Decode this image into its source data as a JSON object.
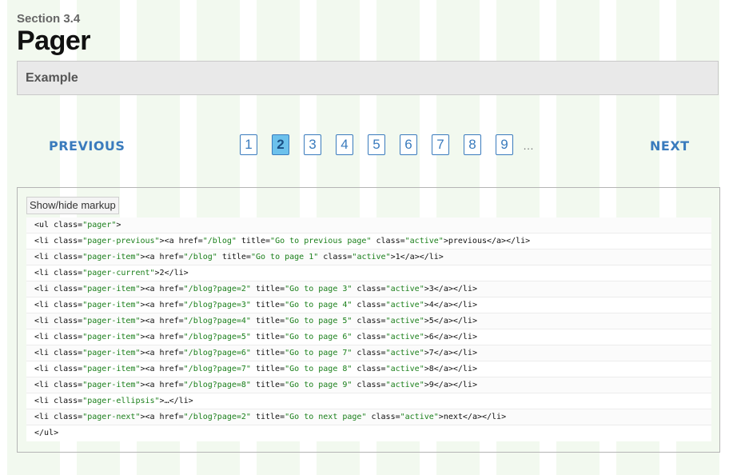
{
  "header": {
    "section": "Section 3.4",
    "title": "Pager"
  },
  "example": {
    "label": "Example"
  },
  "pager": {
    "previous_label": "PREVIOUS",
    "next_label": "NEXT",
    "items": [
      "1",
      "2",
      "3",
      "4",
      "5",
      "6",
      "7",
      "8",
      "9"
    ],
    "current": "2",
    "ellipsis": "…"
  },
  "markup": {
    "toggle_label": "Show/hide markup",
    "lines": [
      [
        [
          "t",
          "<ul class="
        ],
        [
          "s",
          "\"pager\""
        ],
        [
          "t",
          ">"
        ]
      ],
      [
        [
          "t",
          "<li class="
        ],
        [
          "s",
          "\"pager-previous\""
        ],
        [
          "t",
          "><a href="
        ],
        [
          "s",
          "\"/blog\""
        ],
        [
          "t",
          " title="
        ],
        [
          "s",
          "\"Go to previous page\""
        ],
        [
          "t",
          " class="
        ],
        [
          "s",
          "\"active\""
        ],
        [
          "t",
          ">previous</a></li>"
        ]
      ],
      [
        [
          "t",
          "<li class="
        ],
        [
          "s",
          "\"pager-item\""
        ],
        [
          "t",
          "><a href="
        ],
        [
          "s",
          "\"/blog\""
        ],
        [
          "t",
          " title="
        ],
        [
          "s",
          "\"Go to page 1\""
        ],
        [
          "t",
          " class="
        ],
        [
          "s",
          "\"active\""
        ],
        [
          "t",
          ">1</a></li>"
        ]
      ],
      [
        [
          "t",
          "<li class="
        ],
        [
          "s",
          "\"pager-current\""
        ],
        [
          "t",
          ">2</li>"
        ]
      ],
      [
        [
          "t",
          "<li class="
        ],
        [
          "s",
          "\"pager-item\""
        ],
        [
          "t",
          "><a href="
        ],
        [
          "s",
          "\"/blog?page=2\""
        ],
        [
          "t",
          " title="
        ],
        [
          "s",
          "\"Go to page 3\""
        ],
        [
          "t",
          " class="
        ],
        [
          "s",
          "\"active\""
        ],
        [
          "t",
          ">3</a></li>"
        ]
      ],
      [
        [
          "t",
          "<li class="
        ],
        [
          "s",
          "\"pager-item\""
        ],
        [
          "t",
          "><a href="
        ],
        [
          "s",
          "\"/blog?page=3\""
        ],
        [
          "t",
          " title="
        ],
        [
          "s",
          "\"Go to page 4\""
        ],
        [
          "t",
          " class="
        ],
        [
          "s",
          "\"active\""
        ],
        [
          "t",
          ">4</a></li>"
        ]
      ],
      [
        [
          "t",
          "<li class="
        ],
        [
          "s",
          "\"pager-item\""
        ],
        [
          "t",
          "><a href="
        ],
        [
          "s",
          "\"/blog?page=4\""
        ],
        [
          "t",
          " title="
        ],
        [
          "s",
          "\"Go to page 5\""
        ],
        [
          "t",
          " class="
        ],
        [
          "s",
          "\"active\""
        ],
        [
          "t",
          ">5</a></li>"
        ]
      ],
      [
        [
          "t",
          "<li class="
        ],
        [
          "s",
          "\"pager-item\""
        ],
        [
          "t",
          "><a href="
        ],
        [
          "s",
          "\"/blog?page=5\""
        ],
        [
          "t",
          " title="
        ],
        [
          "s",
          "\"Go to page 6\""
        ],
        [
          "t",
          " class="
        ],
        [
          "s",
          "\"active\""
        ],
        [
          "t",
          ">6</a></li>"
        ]
      ],
      [
        [
          "t",
          "<li class="
        ],
        [
          "s",
          "\"pager-item\""
        ],
        [
          "t",
          "><a href="
        ],
        [
          "s",
          "\"/blog?page=6\""
        ],
        [
          "t",
          " title="
        ],
        [
          "s",
          "\"Go to page 7\""
        ],
        [
          "t",
          " class="
        ],
        [
          "s",
          "\"active\""
        ],
        [
          "t",
          ">7</a></li>"
        ]
      ],
      [
        [
          "t",
          "<li class="
        ],
        [
          "s",
          "\"pager-item\""
        ],
        [
          "t",
          "><a href="
        ],
        [
          "s",
          "\"/blog?page=7\""
        ],
        [
          "t",
          " title="
        ],
        [
          "s",
          "\"Go to page 8\""
        ],
        [
          "t",
          " class="
        ],
        [
          "s",
          "\"active\""
        ],
        [
          "t",
          ">8</a></li>"
        ]
      ],
      [
        [
          "t",
          "<li class="
        ],
        [
          "s",
          "\"pager-item\""
        ],
        [
          "t",
          "><a href="
        ],
        [
          "s",
          "\"/blog?page=8\""
        ],
        [
          "t",
          " title="
        ],
        [
          "s",
          "\"Go to page 9\""
        ],
        [
          "t",
          " class="
        ],
        [
          "s",
          "\"active\""
        ],
        [
          "t",
          ">9</a></li>"
        ]
      ],
      [
        [
          "t",
          "<li class="
        ],
        [
          "s",
          "\"pager-ellipsis\""
        ],
        [
          "t",
          ">…</li>"
        ]
      ],
      [
        [
          "t",
          "<li class="
        ],
        [
          "s",
          "\"pager-next\""
        ],
        [
          "t",
          "><a href="
        ],
        [
          "s",
          "\"/blog?page=2\""
        ],
        [
          "t",
          " title="
        ],
        [
          "s",
          "\"Go to next page\""
        ],
        [
          "t",
          " class="
        ],
        [
          "s",
          "\"active\""
        ],
        [
          "t",
          ">next</a></li>"
        ]
      ],
      [
        [
          "t",
          "</ul>"
        ]
      ]
    ]
  },
  "colors": {
    "link": "#3a7bbd",
    "current_page_bg": "#6cc1ec",
    "string_token": "#1a7f1a",
    "grid_stripe": "#f2f9ef"
  }
}
